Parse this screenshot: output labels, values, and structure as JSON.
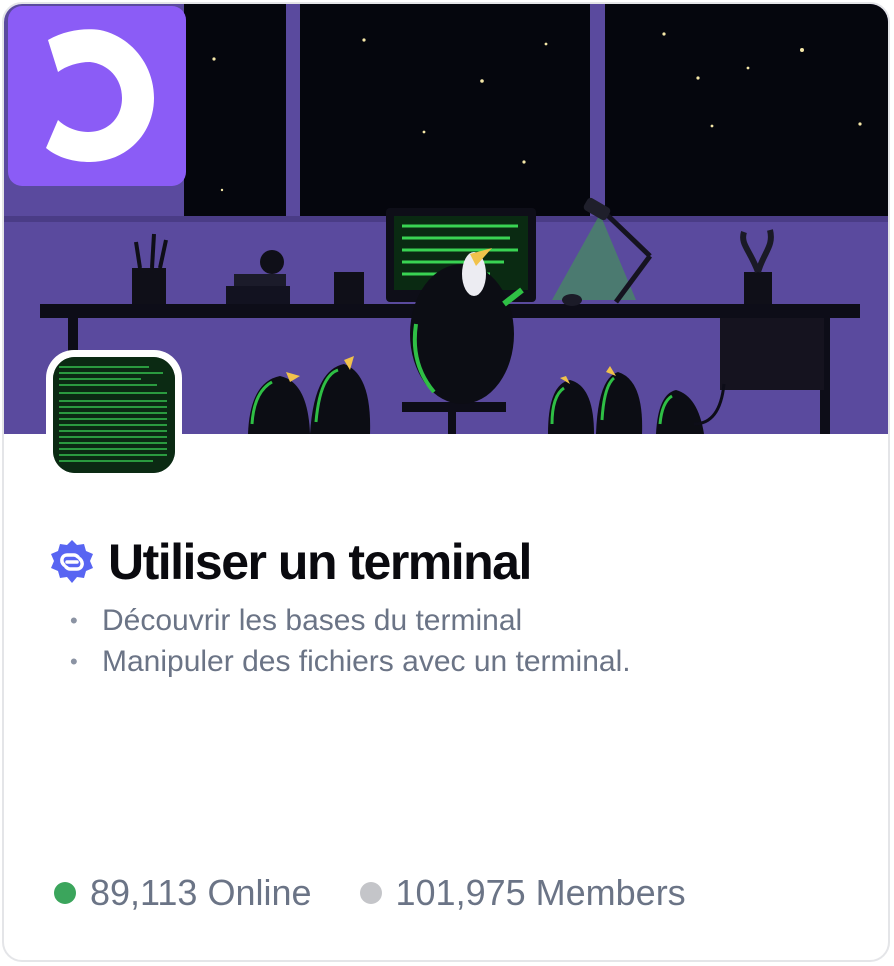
{
  "server": {
    "name": "Utiliser un terminal",
    "description": [
      "Découvrir les bases du terminal",
      "Manipuler des fichiers avec un terminal."
    ],
    "online_text": "89,113 Online",
    "members_text": "101,975 Members"
  },
  "icons": {
    "brand_logo": "openclassrooms-logo-icon",
    "verified_badge": "verified-partner-badge-icon",
    "online_status": "online-status-dot-icon",
    "members_status": "members-dot-icon"
  },
  "colors": {
    "brand_purple": "#8b5cf6",
    "online_green": "#3ba55c",
    "members_gray": "#c4c5c9",
    "verified_blue": "#5865f2",
    "text_title": "#0a0a0f",
    "text_muted": "#6b7486"
  }
}
